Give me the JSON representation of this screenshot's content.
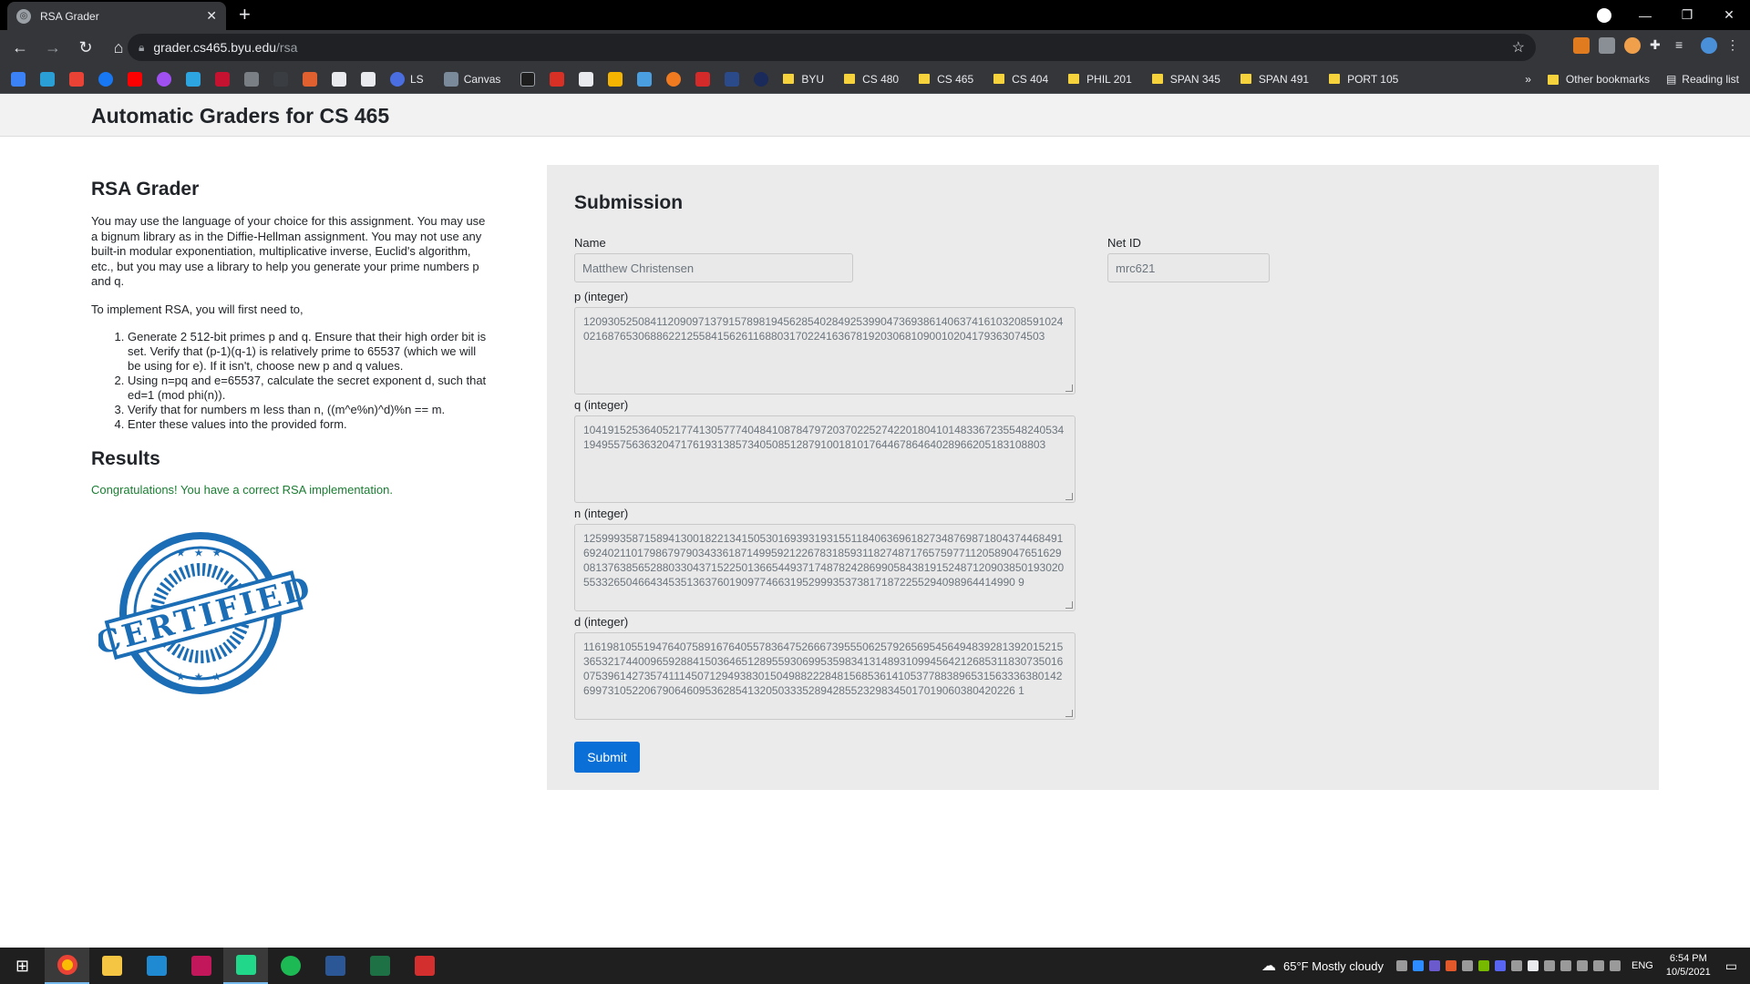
{
  "browser": {
    "tab_title": "RSA Grader",
    "url_host": "grader.cs465.byu.edu",
    "url_path": "/rsa",
    "bookmarks": [
      "LS",
      "Canvas",
      "BYU",
      "CS 480",
      "CS 465",
      "CS 404",
      "PHIL 201",
      "SPAN 345",
      "SPAN 491",
      "PORT 105"
    ],
    "other_bookmarks": "Other bookmarks",
    "reading_list": "Reading list",
    "overflow": "»"
  },
  "page": {
    "site_title": "Automatic Graders for CS 465",
    "left": {
      "heading": "RSA Grader",
      "intro": "You may use the language of your choice for this assignment. You may use a bignum library as in the Diffie-Hellman assignment. You may not use any built-in modular exponentiation, multiplicative inverse, Euclid's algorithm, etc., but you may use a library to help you generate your prime numbers p and q.",
      "lead": "To implement RSA, you will first need to,",
      "steps": [
        "Generate 2 512-bit primes p and q. Ensure that their high order bit is set. Verify that (p-1)(q-1) is relatively prime to 65537 (which we will be using for e). If it isn't, choose new p and q values.",
        "Using n=pq and e=65537, calculate the secret exponent d, such that ed=1 (mod phi(n)).",
        "Verify that for numbers m less than n, ((m^e%n)^d)%n == m.",
        "Enter these values into the provided form."
      ],
      "results_heading": "Results",
      "congrats": "Congratulations! You have a correct RSA implementation.",
      "badge_text": "CERTIFIED"
    },
    "form": {
      "heading": "Submission",
      "name_label": "Name",
      "name_value": "Matthew Christensen",
      "netid_label": "Net ID",
      "netid_value": "mrc621",
      "p_label": "p (integer)",
      "p_value": "12093052508411209097137915789819456285402849253990473693861406374161032085910240216876530688622125584156261168803170224163678192030681090010204179363074503",
      "q_label": "q (integer)",
      "q_value": "10419152536405217741305777404841087847972037022527422018041014833672355482405341949557563632047176193138573405085128791001810176446786464028966205183108803",
      "n_label": "n (integer)",
      "n_value": "12599935871589413001822134150530169393193155118406369618273487698718043744684916924021101798679790343361871499592122678318593118274871765759771120589047651629081376385652880330437152250136654493717487824286990584381915248712090385019302055332650466434535136376019097746631952999353738171872255294098964414990 9",
      "d_label": "d (integer)",
      "d_value": "11619810551947640758916764055783647526667395550625792656954564948392813920152153653217440096592884150364651289559306995359834131489310994564212685311830735016075396142735741114507129493830150498822284815685361410537788389653156333638014269973105220679064609536285413205033352894285523298345017019060380420226 1",
      "submit_label": "Submit"
    }
  },
  "taskbar": {
    "weather": "65°F  Mostly cloudy",
    "lang": "ENG",
    "time": "6:54 PM",
    "date": "10/5/2021"
  }
}
